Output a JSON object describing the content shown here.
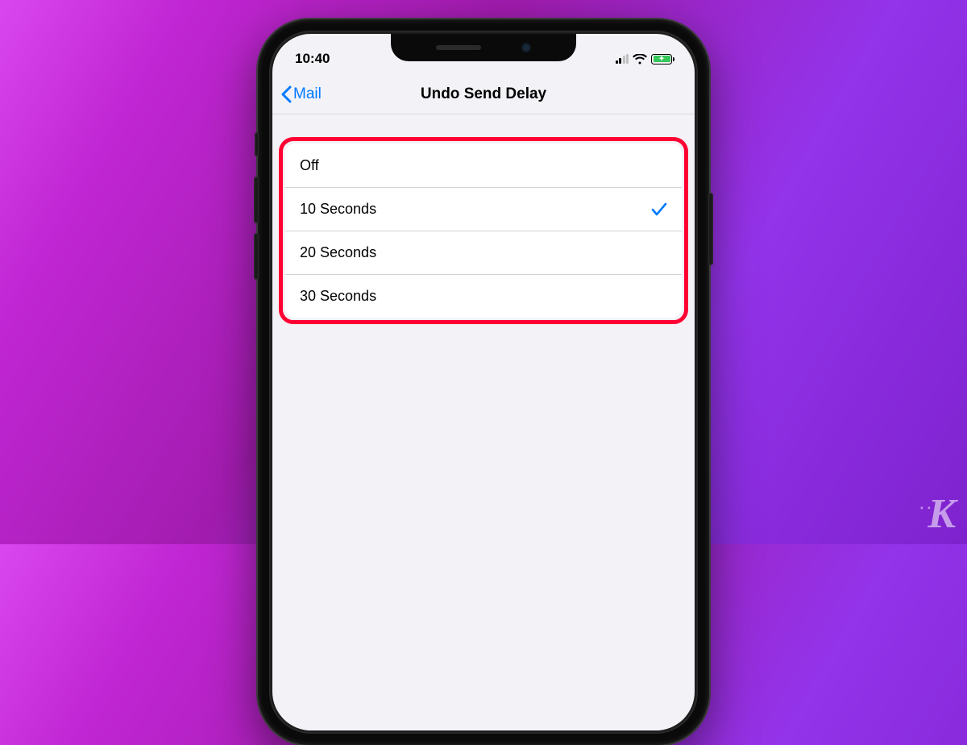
{
  "status_bar": {
    "time": "10:40"
  },
  "nav": {
    "back_label": "Mail",
    "title": "Undo Send Delay"
  },
  "options": [
    {
      "label": "Off",
      "selected": false
    },
    {
      "label": "10 Seconds",
      "selected": true
    },
    {
      "label": "20 Seconds",
      "selected": false
    },
    {
      "label": "30 Seconds",
      "selected": false
    }
  ],
  "watermark": "K"
}
